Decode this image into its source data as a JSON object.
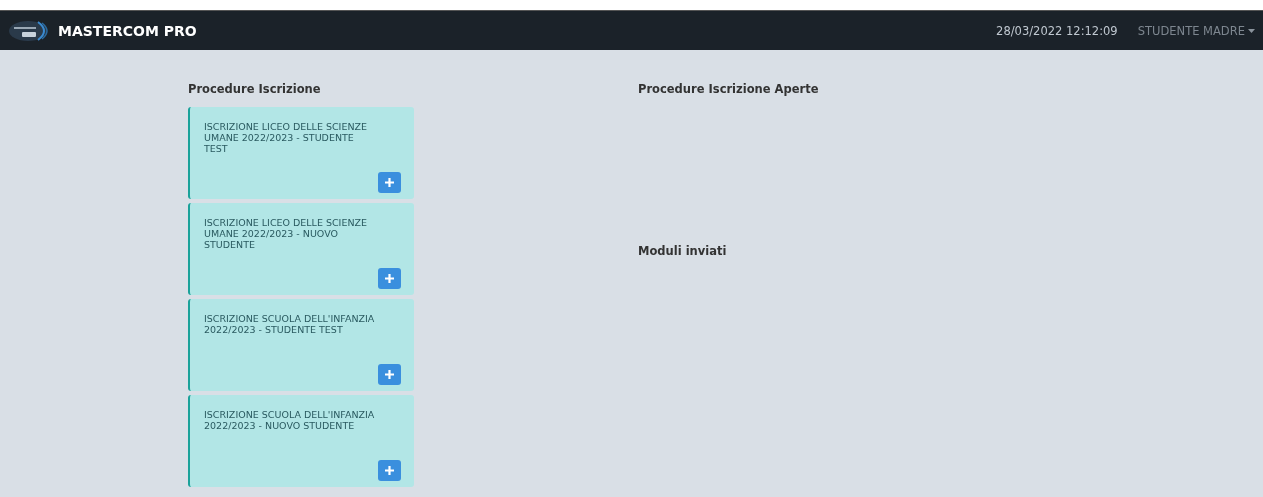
{
  "navbar": {
    "brand": "MASTERCOM PRO",
    "datetime": "28/03/2022 12:12:09",
    "user": "STUDENTE MADRE"
  },
  "procedures": {
    "title": "Procedure Iscrizione",
    "items": [
      {
        "label": "ISCRIZIONE LICEO DELLE SCIENZE UMANE 2022/2023 - STUDENTE TEST"
      },
      {
        "label": "ISCRIZIONE LICEO DELLE SCIENZE UMANE 2022/2023 - NUOVO STUDENTE"
      },
      {
        "label": "ISCRIZIONE SCUOLA DELL'INFANZIA 2022/2023 - STUDENTE TEST"
      },
      {
        "label": "ISCRIZIONE SCUOLA DELL'INFANZIA 2022/2023 - NUOVO STUDENTE"
      }
    ]
  },
  "open_procedures": {
    "title": "Procedure Iscrizione Aperte"
  },
  "sent_forms": {
    "title": "Moduli inviati"
  }
}
